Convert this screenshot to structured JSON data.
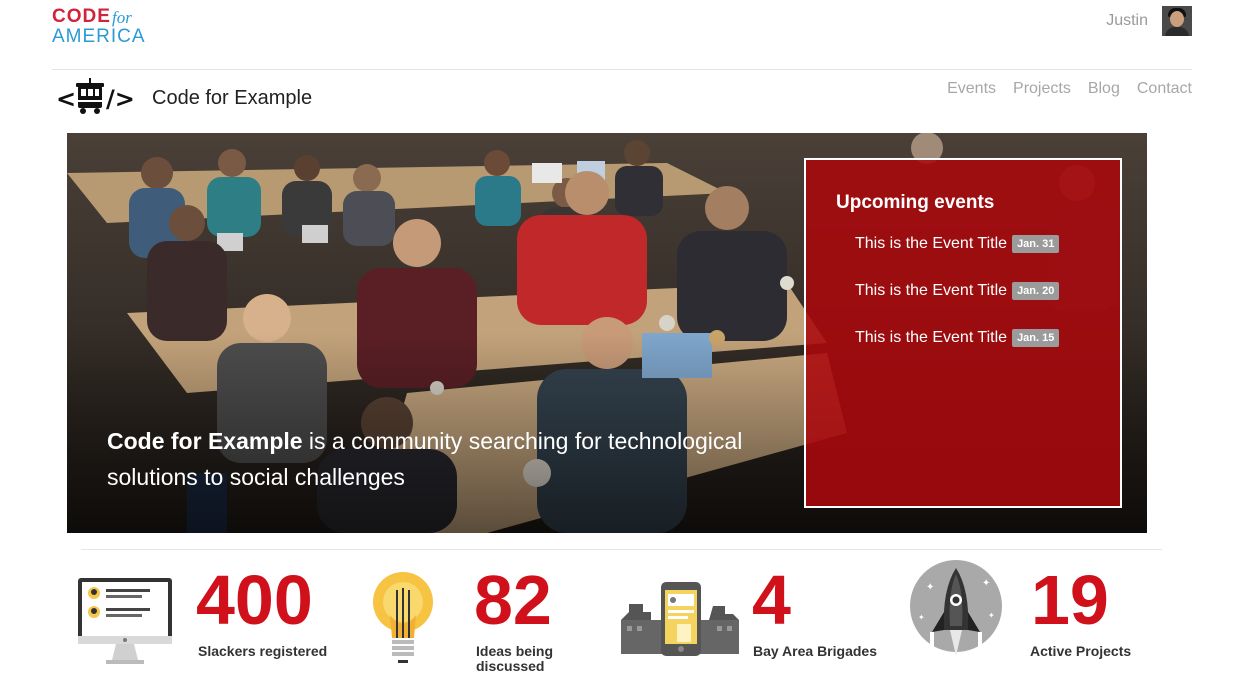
{
  "header": {
    "logo": {
      "code": "CODE",
      "for": "for",
      "america": "AMERICA"
    },
    "user_name": "Justin"
  },
  "brand": {
    "title": "Code for Example",
    "mark_text": "</>"
  },
  "nav": {
    "items": [
      {
        "label": "Events"
      },
      {
        "label": "Projects"
      },
      {
        "label": "Blog"
      },
      {
        "label": "Contact"
      }
    ]
  },
  "hero": {
    "tagline_bold": "Code for Example",
    "tagline_rest": " is a community searching for technological solutions to social challenges"
  },
  "events": {
    "heading": "Upcoming events",
    "items": [
      {
        "title": "This is the Event Title",
        "date": "Jan. 31"
      },
      {
        "title": "This is the Event Title",
        "date": "Jan. 20"
      },
      {
        "title": "This is the Event Title",
        "date": "Jan. 15"
      }
    ]
  },
  "stats": [
    {
      "value": "400",
      "label": "Slackers registered",
      "icon": "monitor-icon"
    },
    {
      "value": "82",
      "label": "Ideas being discussed",
      "icon": "lightbulb-icon"
    },
    {
      "value": "4",
      "label": "Bay Area Brigades",
      "icon": "phone-city-icon"
    },
    {
      "value": "19",
      "label": "Active Projects",
      "icon": "rocket-icon"
    }
  ],
  "colors": {
    "accent_red": "#d0101a",
    "events_panel": "#aa080c",
    "logo_red": "#d0243c",
    "logo_blue": "#2a9ad6"
  }
}
